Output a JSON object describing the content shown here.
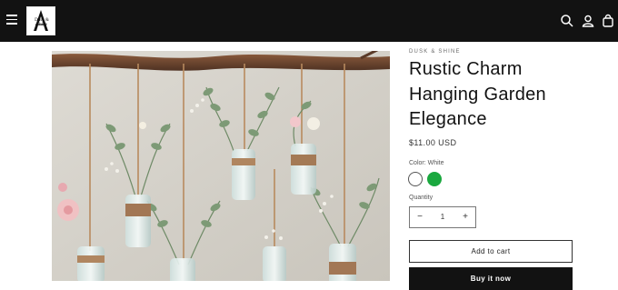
{
  "header": {
    "logo_text": "Dusk & Shine",
    "icons": [
      "menu-icon",
      "search-icon",
      "account-icon",
      "cart-icon"
    ],
    "background": "#121212"
  },
  "product": {
    "vendor": "DUSK & SHINE",
    "title": "Rustic Charm Hanging Garden Elegance",
    "price": "$11.00 USD",
    "color_label": "Color: White",
    "colors": [
      {
        "name": "White",
        "hex": "#ffffff",
        "selected": true
      },
      {
        "name": "Green",
        "hex": "#1aa83f",
        "selected": false
      }
    ],
    "quantity_label": "Quantity",
    "quantity_value": "1",
    "minus_symbol": "−",
    "plus_symbol": "+",
    "add_to_cart_label": "Add to cart",
    "buy_now_label": "Buy it now"
  }
}
